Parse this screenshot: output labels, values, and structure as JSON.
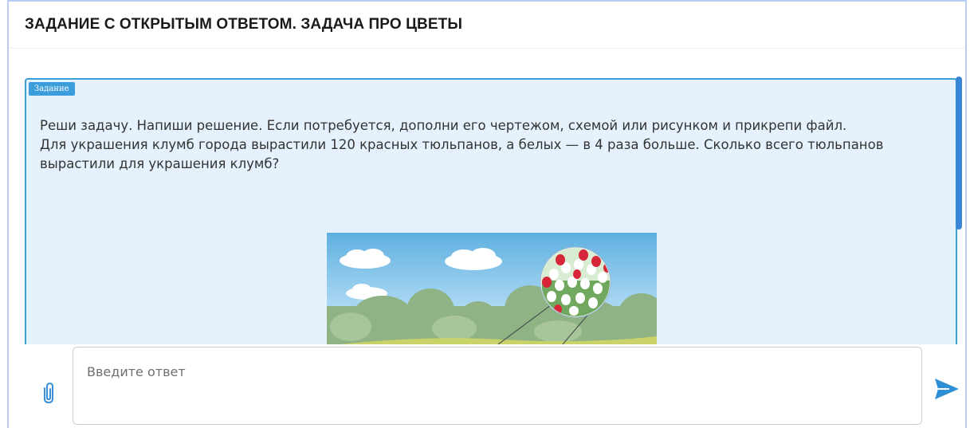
{
  "header": {
    "title": "ЗАДАНИЕ С ОТКРЫТЫМ ОТВЕТОМ. ЗАДАЧА ПРО ЦВЕТЫ"
  },
  "task": {
    "badge": "Задание",
    "paragraphs": [
      "Реши задачу. Напиши решение. Если потребуется, дополни его чертежом, схемой или рисунком и прикрепи файл.",
      "Для украшения клумб города вырастили 120 красных тюльпанов, а белых — в 4 раза больше. Сколько всего тюльпанов вырастили для украшения клумб?"
    ],
    "image": "flower-bed-illustration"
  },
  "answer": {
    "placeholder": "Введите ответ"
  },
  "icons": {
    "attach": "paperclip-icon",
    "send": "send-arrow-icon"
  },
  "colors": {
    "accent": "#3b9dd9",
    "card_background": "#e5f2fd",
    "scrollbar": "#3a86d6"
  }
}
